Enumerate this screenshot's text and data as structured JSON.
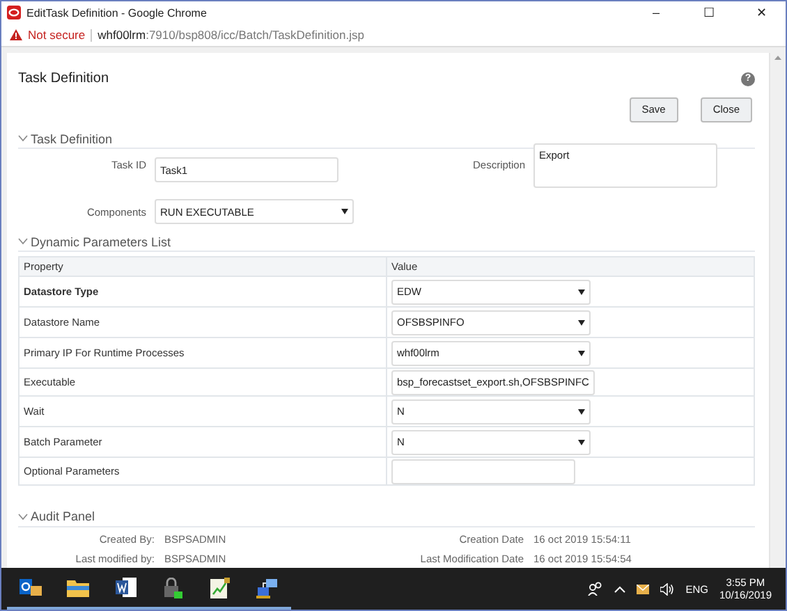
{
  "window": {
    "title": "EditTask Definition - Google Chrome",
    "controls": [
      "–",
      "☐",
      "✕"
    ]
  },
  "address_bar": {
    "warning": "Not secure",
    "host": "whf00lrm",
    "path": ":7910/bsp808/icc/Batch/TaskDefinition.jsp"
  },
  "page": {
    "title": "Task Definition",
    "help": "?",
    "buttons": [
      "Save",
      "Close"
    ]
  },
  "task_section": {
    "header": "Task Definition",
    "expanded": true,
    "fields": {
      "task_id": {
        "label": "Task ID",
        "value": "Task1"
      },
      "description": {
        "label": "Description",
        "value": "Export"
      },
      "components": {
        "label": "Components",
        "value": "RUN EXECUTABLE"
      }
    }
  },
  "parameters_section": {
    "header": "Dynamic Parameters List",
    "expanded": true,
    "columns": [
      "Property",
      "Value"
    ],
    "rows": [
      {
        "property": "Datastore Type",
        "kind": "select",
        "value": "EDW",
        "bold": true
      },
      {
        "property": "Datastore Name",
        "kind": "select",
        "value": "OFSBSPINFO",
        "bold": false
      },
      {
        "property": "Primary IP For Runtime Processes",
        "kind": "select",
        "value": "whf00lrm",
        "bold": false
      },
      {
        "property": "Executable",
        "kind": "input",
        "value": "bsp_forecastset_export.sh,OFSBSPINFC",
        "bold": false
      },
      {
        "property": "Wait",
        "kind": "select",
        "value": "N",
        "bold": false
      },
      {
        "property": "Batch Parameter",
        "kind": "select",
        "value": "N",
        "bold": false
      },
      {
        "property": "Optional Parameters",
        "kind": "input",
        "value": "",
        "bold": false
      }
    ]
  },
  "audit_section": {
    "header": "Audit Panel",
    "expanded": true,
    "rows": [
      {
        "label": "Created By:",
        "value": "BSPSADMIN",
        "date_label": "Creation Date",
        "date": "16 oct 2019 15:54:11"
      },
      {
        "label": "Last modified by:",
        "value": "BSPSADMIN",
        "date_label": "Last Modification Date",
        "date": "16 oct 2019 15:54:54"
      }
    ]
  },
  "taskbar": {
    "apps": [
      {
        "kind": "mail",
        "active": true
      },
      {
        "kind": "folder",
        "active": true
      },
      {
        "kind": "word",
        "active": true
      },
      {
        "kind": "lock",
        "active": true
      },
      {
        "kind": "chart",
        "active": true
      },
      {
        "kind": "network",
        "active": true
      }
    ],
    "language": "ENG",
    "time": "3:55 PM",
    "date": "10/16/2019"
  }
}
